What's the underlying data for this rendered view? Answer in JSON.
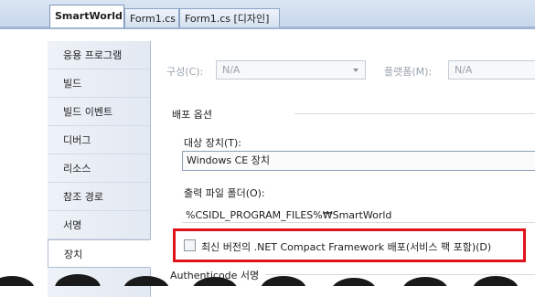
{
  "tabs": [
    {
      "label": "SmartWorld",
      "active": true
    },
    {
      "label": "Form1.cs",
      "active": false
    },
    {
      "label": "Form1.cs [디자인]",
      "active": false
    }
  ],
  "nav": {
    "items": [
      {
        "label": "응용 프로그램"
      },
      {
        "label": "빌드"
      },
      {
        "label": "빌드 이벤트"
      },
      {
        "label": "디버그"
      },
      {
        "label": "리소스"
      },
      {
        "label": "참조 경로"
      },
      {
        "label": "서명"
      },
      {
        "label": "장치"
      }
    ],
    "active_index": 7
  },
  "config": {
    "config_label": "구성(C):",
    "config_value": "N/A",
    "platform_label": "플랫폼(M):",
    "platform_value": "N/A"
  },
  "deploy": {
    "group_label": "배포 옵션",
    "target_label": "대상 장치(T):",
    "target_value": "Windows CE 장치",
    "output_label": "출력 파일 폴더(O):",
    "output_value": "%CSIDL_PROGRAM_FILES%₩SmartWorld",
    "checkbox_label": "최신 버전의 .NET Compact Framework 배포(서비스 팩 포함)(D)",
    "checkbox_checked": false
  },
  "authenticode": {
    "group_label": "Authenticode 서명"
  },
  "colors": {
    "highlight": "#e0121b",
    "tab_strip": "#c6d6ea",
    "nav_background": "#e3e9f2"
  }
}
